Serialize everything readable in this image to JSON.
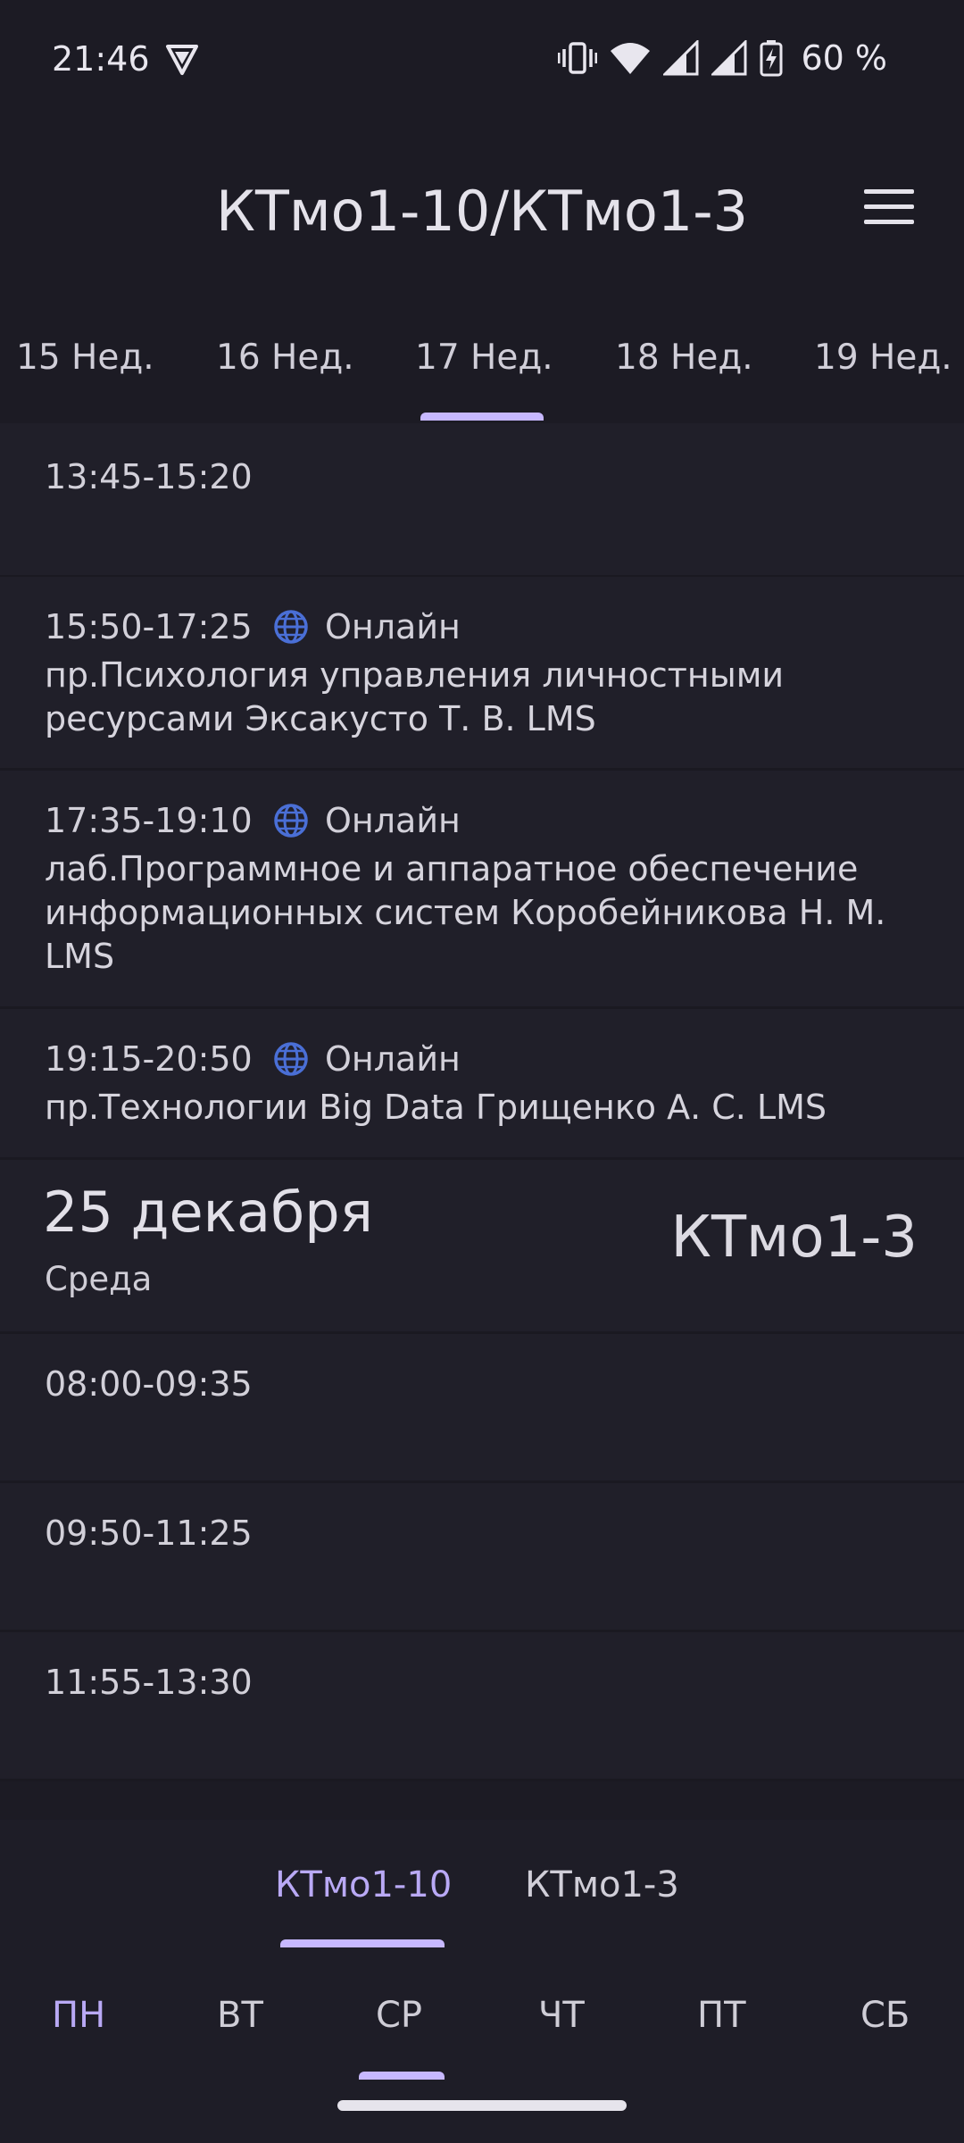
{
  "status_bar": {
    "time": "21:46",
    "battery": "60 %",
    "icons": [
      "vpn-icon",
      "vibrate-icon",
      "wifi-icon",
      "signal-icon",
      "signal-icon",
      "battery-charging-icon"
    ]
  },
  "app_bar": {
    "title": "КТмо1-10/КТмо1-3",
    "menu_icon": "hamburger-menu-icon"
  },
  "week_tabs": [
    "15 Нед.",
    "16 Нед.",
    "17 Нед.",
    "18 Нед.",
    "19 Нед."
  ],
  "selected_week": "17 Нед.",
  "schedule": {
    "slots_before": [
      {
        "time": "13:45-15:20"
      },
      {
        "time": "15:50-17:25",
        "mode": "Онлайн",
        "lesson": "пр.Психология управления личностными ресурсами Эксакусто Т. В. LMS"
      },
      {
        "time": "17:35-19:10",
        "mode": "Онлайн",
        "lesson": "лаб.Программное и аппаратное обеспечение информационных систем Коробейникова Н. М. LMS"
      },
      {
        "time": "19:15-20:50",
        "mode": "Онлайн",
        "lesson": "пр.Технологии Big Data Грищенко А. С. LMS"
      }
    ],
    "day": {
      "date": "25 декабря",
      "weekday": "Среда",
      "group": "КТмо1-3"
    },
    "slots_after": [
      {
        "time": "08:00-09:35"
      },
      {
        "time": "09:50-11:25"
      },
      {
        "time": "11:55-13:30"
      }
    ]
  },
  "group_tabs": [
    "КТмо1-10",
    "КТмо1-3"
  ],
  "selected_group": "КТмо1-10",
  "weekdays": [
    "ПН",
    "ВТ",
    "СР",
    "ЧТ",
    "ПТ",
    "СБ"
  ],
  "selected_weekday": "СР",
  "colors": {
    "background": "#1c1b24",
    "card": "#201f29",
    "accent": "#c7b8ff",
    "globe": "#4a6fd6",
    "highlight_text": "#b9a9f5"
  }
}
